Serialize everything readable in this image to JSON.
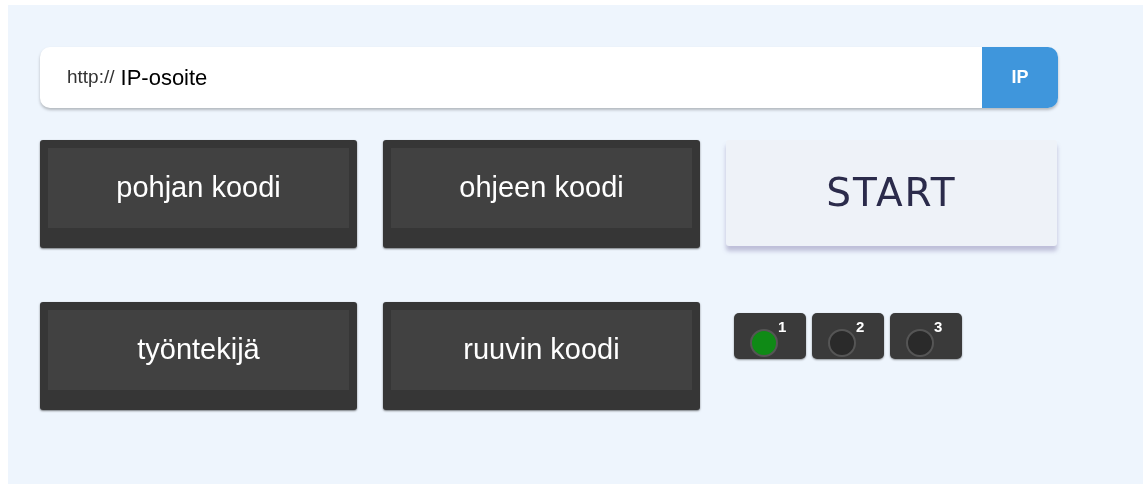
{
  "address_bar": {
    "prefix": "http://",
    "value": "IP-osoite",
    "button": "IP"
  },
  "buttons": [
    {
      "label": "pohjan koodi",
      "kind": "dark"
    },
    {
      "label": "ohjeen koodi",
      "kind": "dark"
    },
    {
      "label": "START",
      "kind": "light"
    },
    {
      "label": "työntekijä",
      "kind": "dark"
    },
    {
      "label": "ruuvin koodi",
      "kind": "dark"
    },
    {
      "kind": "indicators"
    }
  ],
  "indicators": [
    {
      "label": "1",
      "on": true
    },
    {
      "label": "2",
      "on": false
    },
    {
      "label": "3",
      "on": false
    }
  ]
}
